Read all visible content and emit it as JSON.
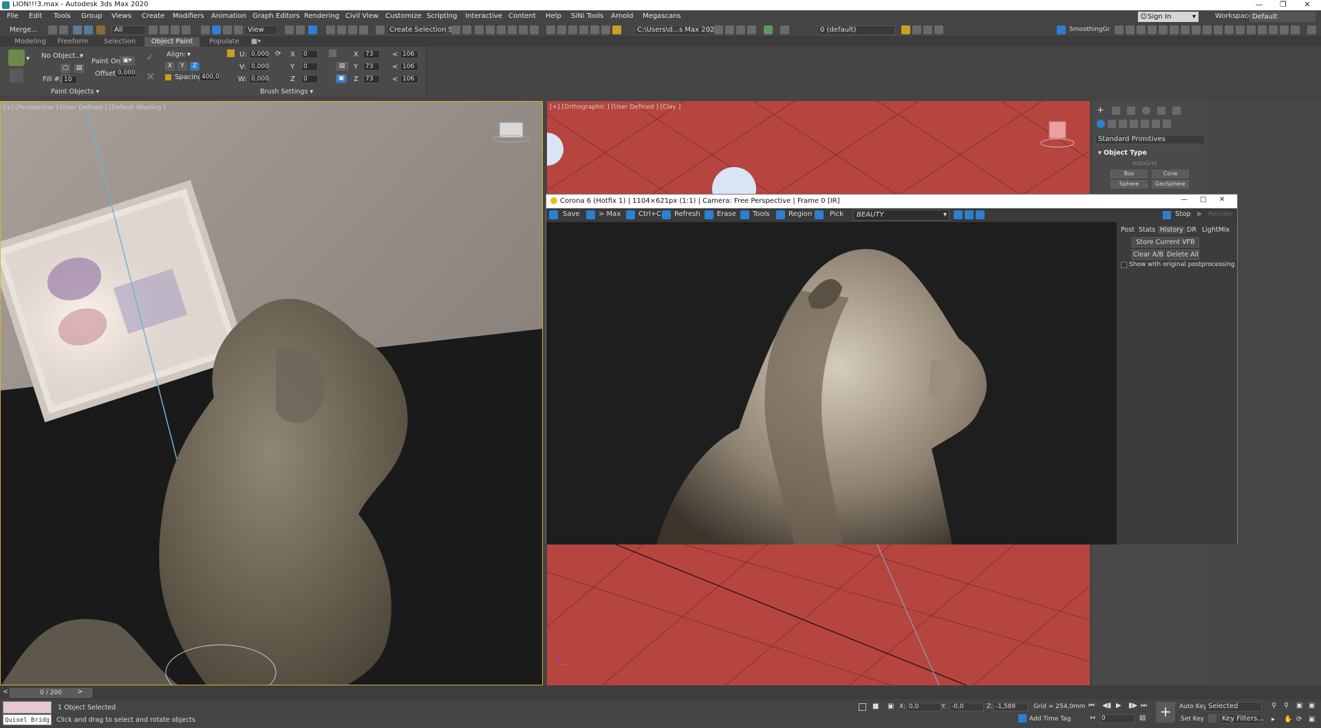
{
  "window": {
    "title": "LION!!!3.max - Autodesk 3ds Max 2020"
  },
  "menubar": {
    "items": [
      "File",
      "Edit",
      "Tools",
      "Group",
      "Views",
      "Create",
      "Modifiers",
      "Animation",
      "Graph Editors",
      "Rendering",
      "Civil View",
      "Customize",
      "Scripting",
      "Interactive",
      "Content",
      "Help",
      "SiNi Tools",
      "Arnold",
      "Megascans"
    ],
    "sign_in": "Sign In",
    "workspaces_label": "Workspaces:",
    "workspace": "Default"
  },
  "toolbar": {
    "merge": "Merge...",
    "filter": "All",
    "view": "View",
    "selection_set": "Create Selection Se",
    "path": "C:\\Users\\d...s Max 2020",
    "layer": "0 (default)",
    "smoothing": "SmoothingGr"
  },
  "ribbon_tabs": [
    "Modeling",
    "Freeform",
    "Selection",
    "Object Paint",
    "Populate"
  ],
  "ribbon": {
    "no_object": "No Object...",
    "paint_on": "Paint On:",
    "fill_label": "Fill #:",
    "fill_value": "10",
    "offset_label": "Offset:",
    "offset_value": "0,000",
    "align_label": "Align:",
    "axes": [
      "X",
      "Y",
      "Z"
    ],
    "spacing_label": "Spacing:",
    "spacing_value": "400,0",
    "u_label": "U:",
    "u_value": "0,000",
    "v_label": "V:",
    "v_value": "0,000",
    "w_label": "W:",
    "w_value": "0,000",
    "x_label": "X",
    "x_value": "0",
    "y_label": "Y",
    "y_value": "0",
    "z_label": "Z",
    "z_value": "0",
    "sx_value": "73",
    "sy_value": "73",
    "sz_value": "73",
    "c1": "106",
    "c2": "106",
    "c3": "106",
    "group_paint": "Paint Objects",
    "group_brush": "Brush Settings"
  },
  "viewports": {
    "left_label": "[+] [Perspective ] [User Defined ] [Default Shading ]",
    "tr_label": "[+] [Orthographic ] [User Defined ] [Clay ]"
  },
  "command_panel": {
    "category": "Standard Primitives",
    "rollout": "Object Type",
    "autogrid": "AutoGrid",
    "buttons": [
      "Box",
      "Cone",
      "Sphere",
      "GeoSphere"
    ]
  },
  "vfb": {
    "title": "Corona 6 (Hotfix 1) | 1104×621px (1:1) | Camera: Free Perspective | Frame 0 [IR]",
    "toolbar": {
      "save": "Save",
      "to_max": "> Max",
      "copy": "Ctrl+C",
      "refresh": "Refresh",
      "erase": "Erase",
      "tools": "Tools",
      "region": "Region",
      "pick": "Pick",
      "channel": "BEAUTY",
      "stop": "Stop",
      "render": "Render"
    },
    "tabs": [
      "Post",
      "Stats",
      "History",
      "DR",
      "LightMix"
    ],
    "store": "Store Current VFB",
    "clear": "Clear A/B",
    "delete": "Delete All",
    "show_original": "Show with original postprocessing"
  },
  "status": {
    "frame": "0 / 200",
    "selected": "1 Object Selected",
    "prompt": "Click and drag to select and rotate objects",
    "quixel": "Quixel Bridg",
    "x_label": "X:",
    "x": "0,0",
    "y_label": "Y:",
    "y": "-0,0",
    "z_label": "Z:",
    "z": "-1,589",
    "grid": "Grid = 254,0mm",
    "add_time_tag": "Add Time Tag",
    "auto_key": "Auto Key",
    "set_key": "Set Key",
    "selected_dd": "Selected",
    "key_filters": "Key Filters...",
    "frame_field": "0"
  },
  "colors": {
    "accent": "#2d7fd1",
    "viewport_red": "#b5453e",
    "active_border": "#d8b232"
  }
}
